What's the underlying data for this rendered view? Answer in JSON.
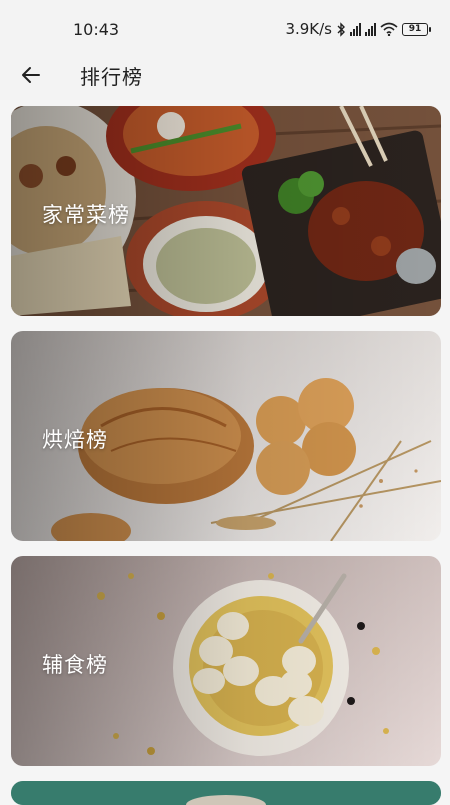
{
  "status_bar": {
    "time": "10:43",
    "network_speed": "3.9K/s",
    "battery": "91",
    "icons": [
      "bluetooth-icon",
      "signal-hd-icon",
      "signal-hd-icon",
      "wifi-icon",
      "battery-icon"
    ]
  },
  "header": {
    "back_icon": "arrow-left-icon",
    "title": "排行榜"
  },
  "rankings": [
    {
      "label": "家常菜榜",
      "image": "home-cooking-photo"
    },
    {
      "label": "烘焙榜",
      "image": "baking-photo"
    },
    {
      "label": "辅食榜",
      "image": "baby-food-photo"
    },
    {
      "label": "",
      "image": "next-category-photo"
    }
  ],
  "colors": {
    "background": "#f5f5f5",
    "card_text": "#ffffff"
  }
}
